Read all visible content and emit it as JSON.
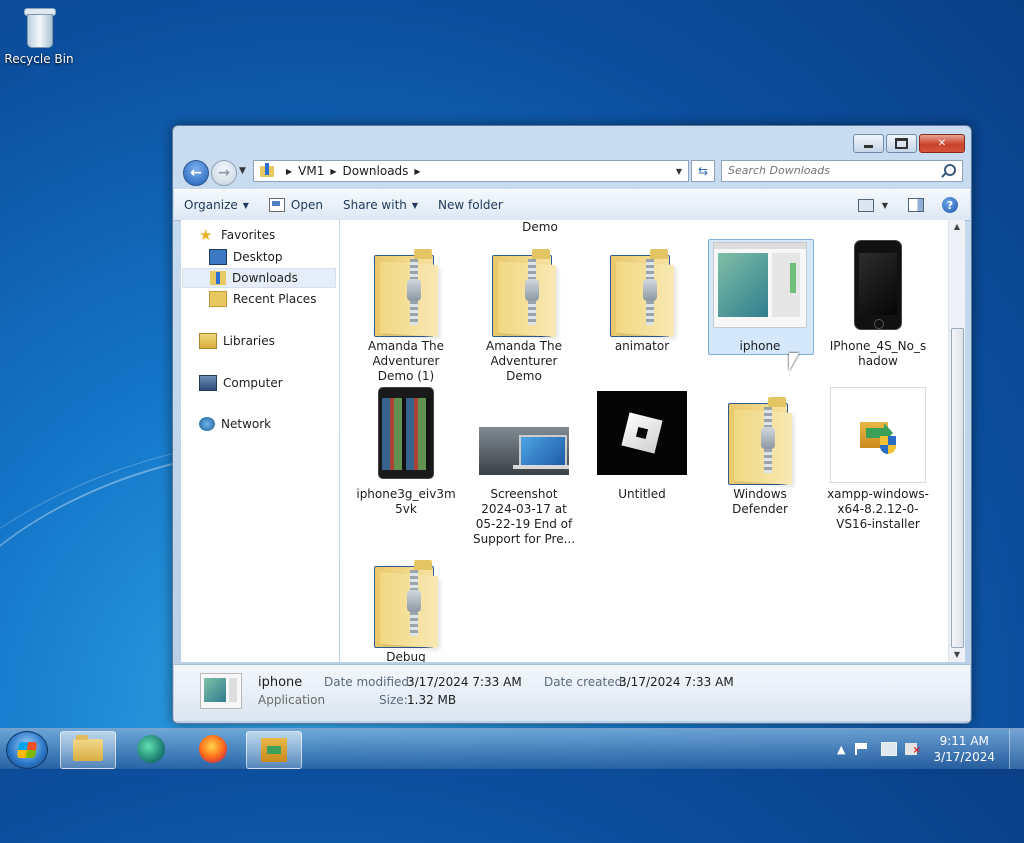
{
  "desktop": {
    "icons": [
      {
        "label": "Recycle Bin",
        "icon": "recycle-bin-icon"
      }
    ]
  },
  "window": {
    "nav": {
      "breadcrumb": [
        "VM1",
        "Downloads"
      ],
      "search_placeholder": "Search Downloads"
    },
    "toolbar": {
      "organize": "Organize",
      "open": "Open",
      "share_with": "Share with",
      "new_folder": "New folder"
    },
    "sidebar": {
      "favorites": "Favorites",
      "desktop": "Desktop",
      "downloads": "Downloads",
      "recent_places": "Recent Places",
      "libraries": "Libraries",
      "computer": "Computer",
      "network": "Network"
    },
    "files": {
      "partial_top_label": "Demo",
      "items": [
        {
          "label": "Amanda The Adventurer Demo (1)",
          "type": "zip-folder"
        },
        {
          "label": "Amanda The Adventurer Demo",
          "type": "zip-folder"
        },
        {
          "label": "animator",
          "type": "zip-folder"
        },
        {
          "label": "iphone",
          "type": "application",
          "selected": true
        },
        {
          "label": "IPhone_4S_No_shadow",
          "type": "image"
        },
        {
          "label": "iphone3g_eiv3m5vk",
          "type": "image"
        },
        {
          "label": "Screenshot 2024-03-17 at 05-22-19 End of Support for Pre...",
          "type": "image"
        },
        {
          "label": "Untitled",
          "type": "image"
        },
        {
          "label": "Windows Defender",
          "type": "zip-folder"
        },
        {
          "label": "xampp-windows-x64-8.2.12-0-VS16-installer",
          "type": "installer"
        },
        {
          "label": "Debug",
          "type": "zip-folder"
        }
      ]
    },
    "details": {
      "name": "iphone",
      "type": "Application",
      "date_modified_label": "Date modified:",
      "date_modified": "3/17/2024 7:33 AM",
      "date_created_label": "Date created:",
      "date_created": "3/17/2024 7:33 AM",
      "size_label": "Size:",
      "size": "1.32 MB"
    }
  },
  "taskbar": {
    "clock_time": "9:11 AM",
    "clock_date": "3/17/2024",
    "tray_expand": "▲"
  }
}
